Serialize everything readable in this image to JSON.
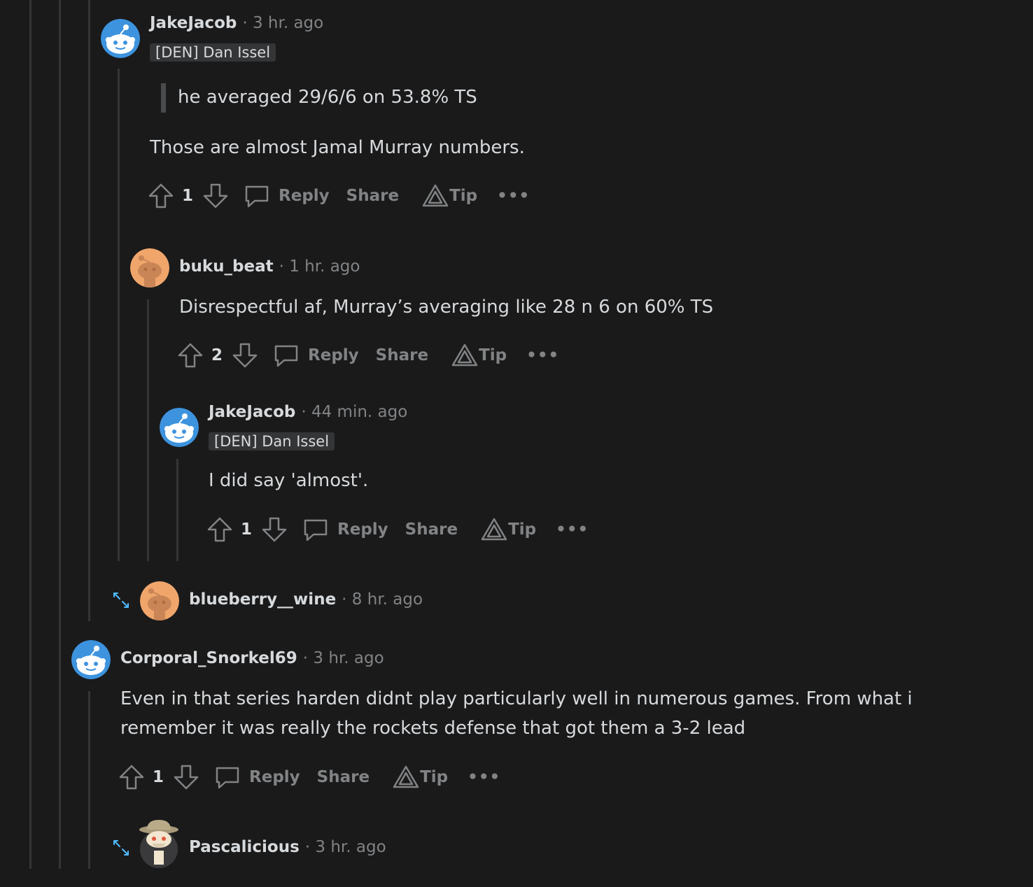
{
  "comments": [
    {
      "author": "JakeJacob",
      "time": "· 3 hr. ago",
      "flair": "[DEN] Dan Issel",
      "quote": "he averaged 29/6/6 on 53.8% TS",
      "body": "Those are almost Jamal Murray numbers.",
      "score": "1",
      "avatar": "snoo-blue"
    },
    {
      "author": "buku_beat",
      "time": "· 1 hr. ago",
      "body": "Disrespectful af, Murray’s averaging like 28 n 6 on 60% TS",
      "score": "2",
      "avatar": "snoo-orange"
    },
    {
      "author": "JakeJacob",
      "time": "· 44 min. ago",
      "flair": "[DEN] Dan Issel",
      "body": "I did say 'almost'.",
      "score": "1",
      "avatar": "snoo-blue"
    },
    {
      "author": "blueberry__wine",
      "time": "· 8 hr. ago",
      "collapsed": true,
      "avatar": "snoo-orange"
    },
    {
      "author": "Corporal_Snorkel69",
      "time": "· 3 hr. ago",
      "body_lines": [
        "Even in that series harden didnt play particularly well in numerous games. From what i",
        "remember it was really the rockets defense that got them a 3-2 lead"
      ],
      "score": "1",
      "avatar": "snoo-blue"
    },
    {
      "author": "Pascalicious",
      "time": "· 3 hr. ago",
      "collapsed": true,
      "avatar": "snoo-explorer"
    }
  ],
  "actions": {
    "reply": "Reply",
    "share": "Share",
    "tip": "Tip",
    "more": "•••"
  },
  "colors": {
    "background": "#1a1a1b",
    "text": "#d7dadc",
    "muted": "#818384",
    "thread_line": "#343536",
    "blue_avatar": "#3d93de",
    "orange_avatar": "#f0a66b",
    "expand_icon": "#4fbcff"
  }
}
